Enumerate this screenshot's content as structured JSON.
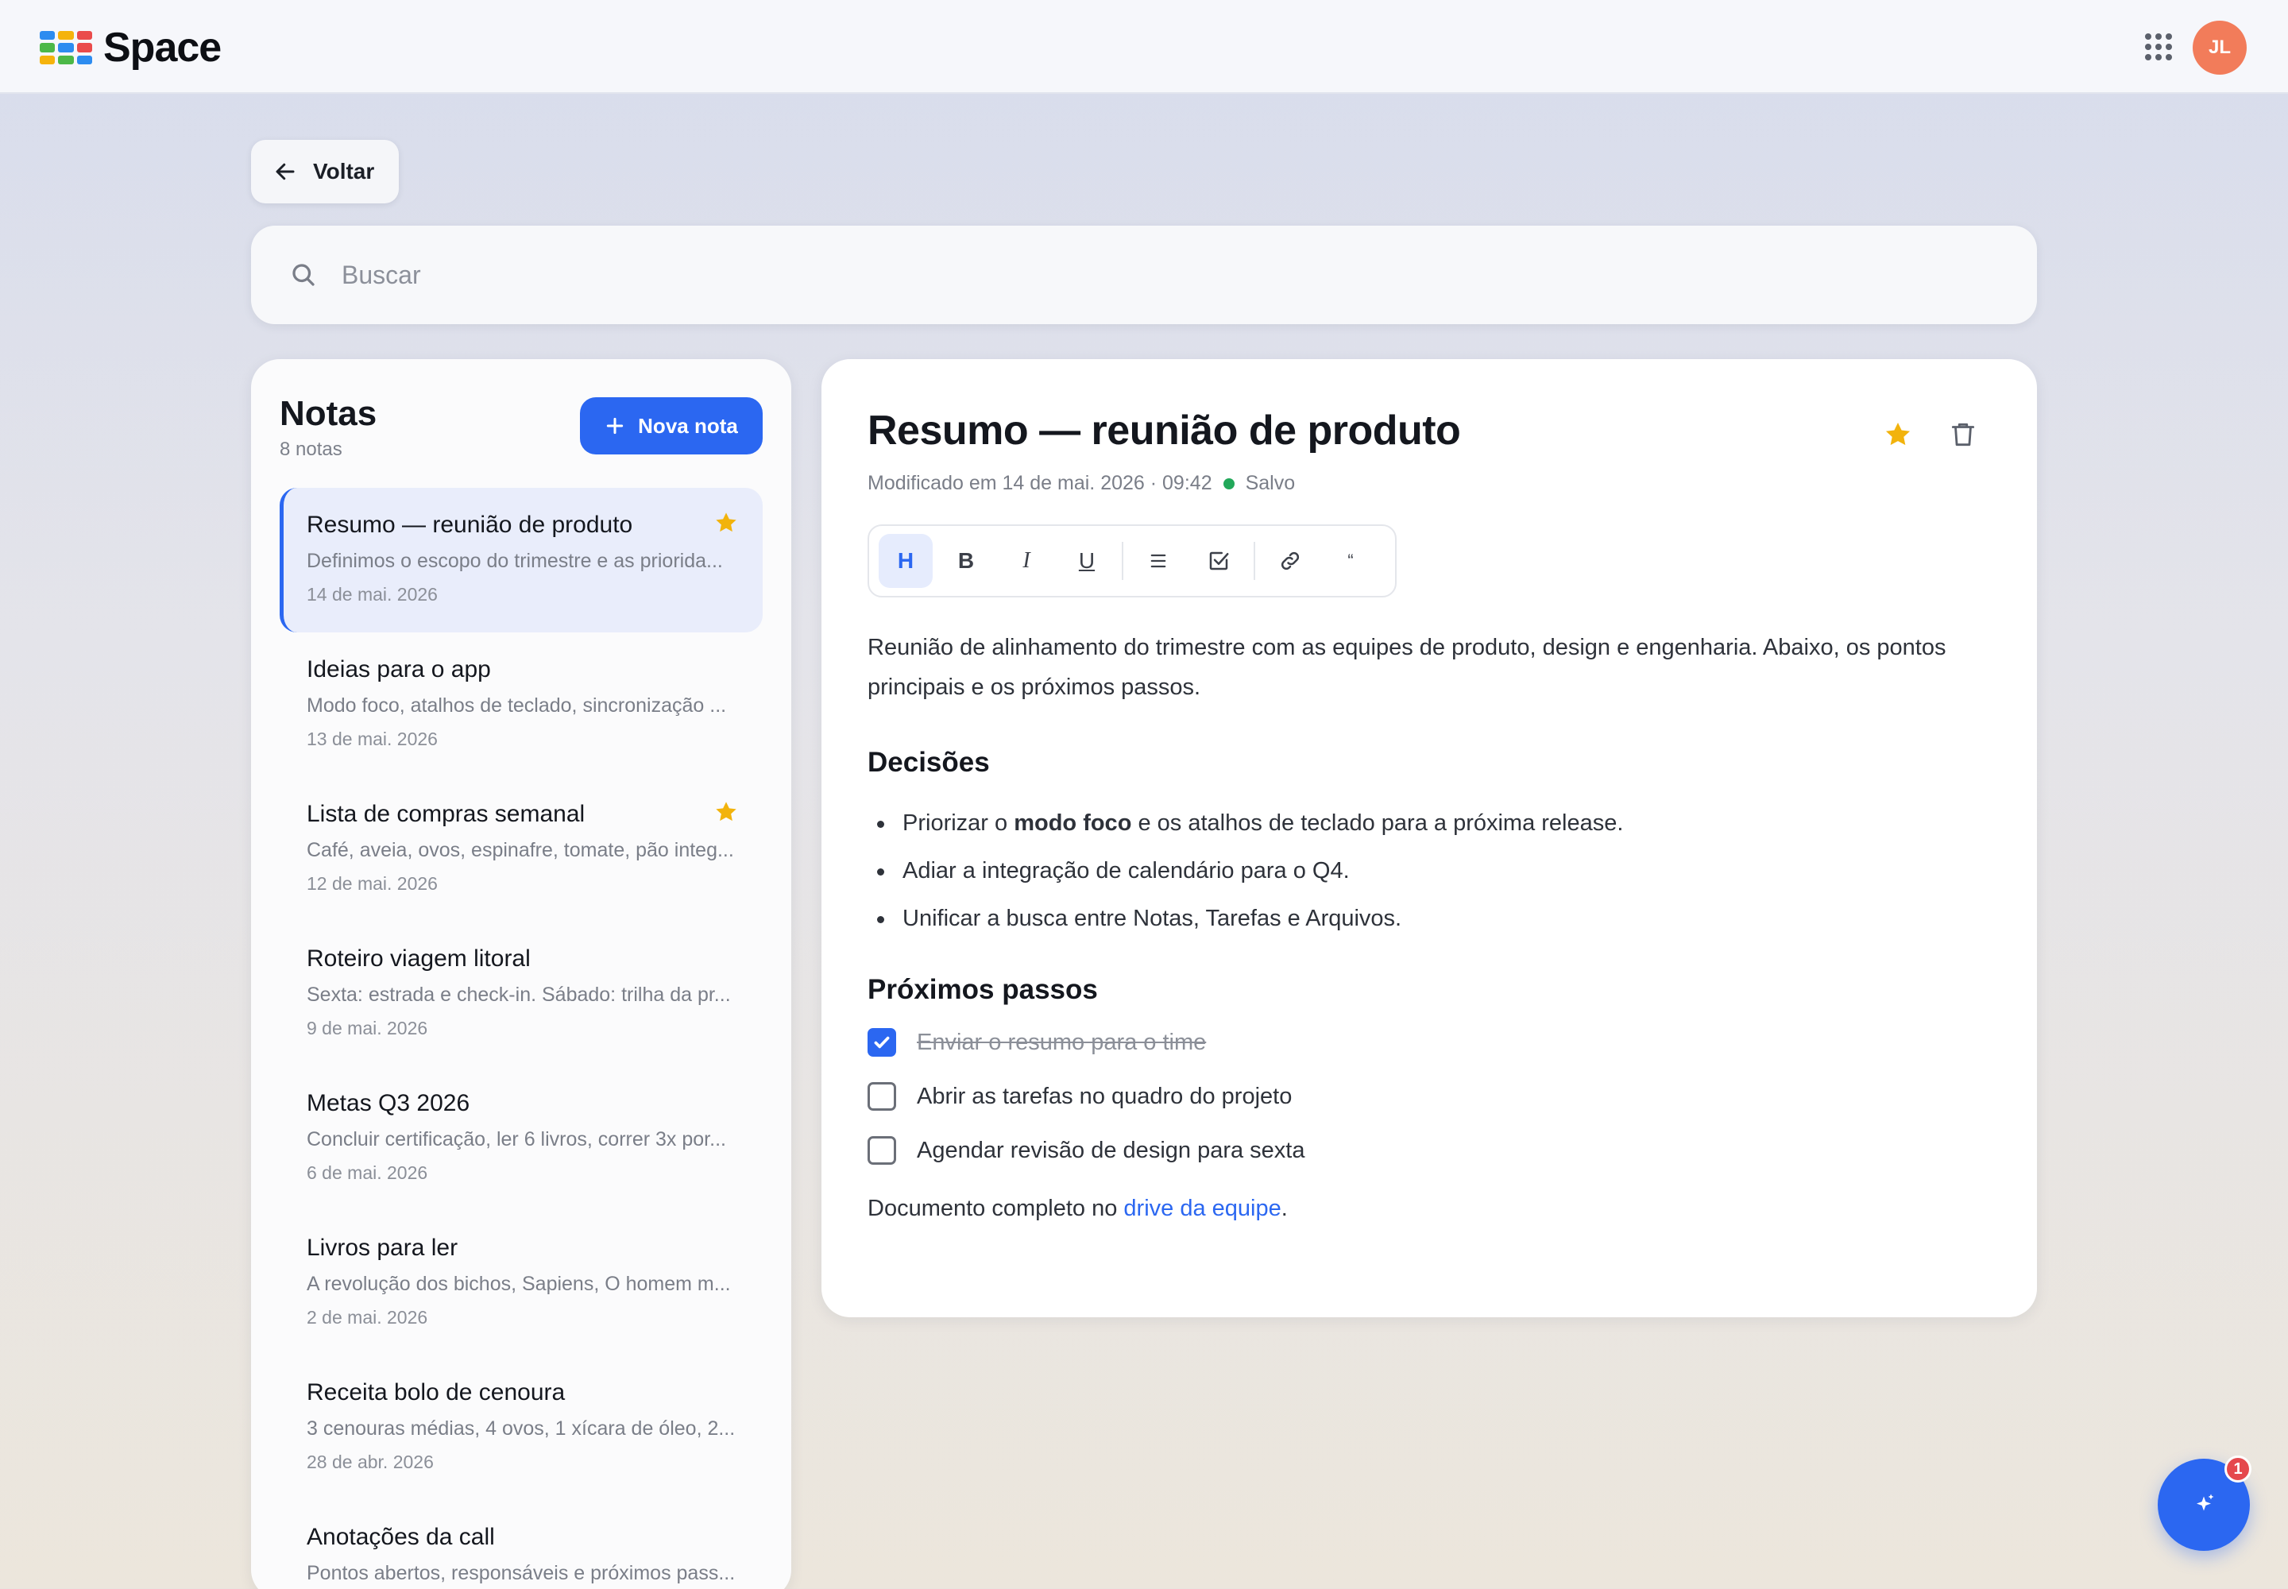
{
  "app": {
    "name": "Space"
  },
  "user": {
    "initials": "JL"
  },
  "colors": {
    "accent": "#2b67f1",
    "star": "#f2b30c",
    "saved": "#22a85a",
    "badge": "#e5484d"
  },
  "nav": {
    "back_label": "Voltar"
  },
  "search": {
    "placeholder": "Buscar"
  },
  "notes": {
    "title": "Notas",
    "count": "8 notas",
    "new_note_label": "Nova nota",
    "items": [
      {
        "title": "Resumo — reunião de produto",
        "snippet": "Definimos o escopo do trimestre e as priorida...",
        "date": "14 de mai. 2026",
        "starred": true,
        "active": true
      },
      {
        "title": "Ideias para o app",
        "snippet": "Modo foco, atalhos de teclado, sincronização ...",
        "date": "13 de mai. 2026",
        "starred": false,
        "active": false
      },
      {
        "title": "Lista de compras semanal",
        "snippet": "Café, aveia, ovos, espinafre, tomate, pão integ...",
        "date": "12 de mai. 2026",
        "starred": true,
        "active": false
      },
      {
        "title": "Roteiro viagem litoral",
        "snippet": "Sexta: estrada e check-in. Sábado: trilha da pr...",
        "date": "9 de mai. 2026",
        "starred": false,
        "active": false
      },
      {
        "title": "Metas Q3 2026",
        "snippet": "Concluir certificação, ler 6 livros, correr 3x por...",
        "date": "6 de mai. 2026",
        "starred": false,
        "active": false
      },
      {
        "title": "Livros para ler",
        "snippet": "A revolução dos bichos, Sapiens, O homem m...",
        "date": "2 de mai. 2026",
        "starred": false,
        "active": false
      },
      {
        "title": "Receita bolo de cenoura",
        "snippet": "3 cenouras médias, 4 ovos, 1 xícara de óleo, 2...",
        "date": "28 de abr. 2026",
        "starred": false,
        "active": false
      },
      {
        "title": "Anotações da call",
        "snippet": "Pontos abertos, responsáveis e próximos pass...",
        "date": "",
        "starred": false,
        "active": false
      }
    ]
  },
  "editor": {
    "title": "Resumo — reunião de produto",
    "modified": "Modificado em 14 de mai. 2026 · 09:42",
    "status": "Salvo",
    "toolbar": {
      "heading": "H",
      "bold": "B",
      "italic": "I",
      "underline": "U",
      "quote": "“"
    },
    "intro": "Reunião de alinhamento do trimestre com as equipes de produto, design e engenharia. Abaixo, os pontos principais e os próximos passos.",
    "decisions_heading": "Decisões",
    "decision_1_pre": "Priorizar o ",
    "decision_1_bold": "modo foco",
    "decision_1_post": " e os atalhos de teclado para a próxima release.",
    "decision_2": "Adiar a integração de calendário para o Q4.",
    "decision_3": "Unificar a busca entre Notas, Tarefas e Arquivos.",
    "next_heading": "Próximos passos",
    "todos": [
      {
        "text": "Enviar o resumo para o time",
        "done": true
      },
      {
        "text": "Abrir as tarefas no quadro do projeto",
        "done": false
      },
      {
        "text": "Agendar revisão de design para sexta",
        "done": false
      }
    ],
    "footer_pre": "Documento completo no ",
    "footer_link": "drive da equipe",
    "footer_post": "."
  },
  "fab": {
    "badge": "1"
  }
}
